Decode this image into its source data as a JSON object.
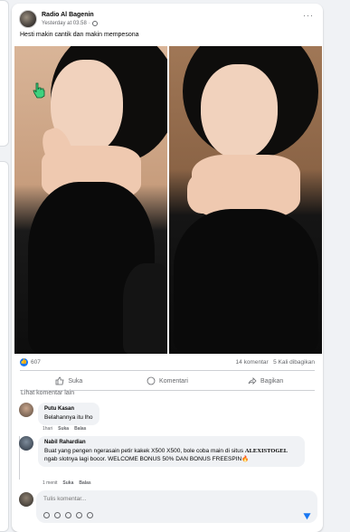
{
  "post": {
    "author": "Radio Al Bagenin",
    "timestamp": "Yesterday at 03.58",
    "caption": "Hesti makin cantik dan makin mempesona",
    "more_icon": "more-horizontal-icon",
    "privacy_icon": "globe-icon"
  },
  "stats": {
    "reaction_count": "607",
    "comments": "14 komentar",
    "shares": "5 Kali dibagikan"
  },
  "actions": {
    "like": "Suka",
    "comment": "Komentari",
    "share": "Bagikan"
  },
  "see_more_comments": "Lihat komentar lain",
  "comments": [
    {
      "author": "Putu Kasan",
      "text": "Belahannya itu lho",
      "time": "1hari",
      "like": "Suka",
      "reply": "Balas"
    },
    {
      "author": "Nabil Rahardian",
      "text_1": "Buat yang pengen ngerasain petir kakek X500 X500, bole coba main di situs",
      "brand": "ALEXISTOGEL",
      "text_2": " ngab slotnya lagi bocor. WELCOME BONUS 50% DAN BONUS FREESPIN",
      "emoji": "🔥",
      "time": "1 menit",
      "like": "Suka",
      "reply": "Balas"
    }
  ],
  "composer": {
    "placeholder": "Tulis komentar..."
  },
  "colors": {
    "accent": "#1877f2",
    "background": "#f0f2f5"
  }
}
